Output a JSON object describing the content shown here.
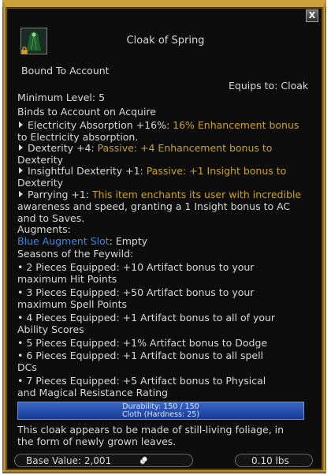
{
  "close_label": "X",
  "item": {
    "title": "Cloak of Spring",
    "bound": "Bound To Account",
    "equips_to": "Equips to: Cloak",
    "min_level": "Minimum Level: 5",
    "binds": "Binds to Account on Acquire",
    "effects": [
      {
        "name": "Electricity Absorption +16%:",
        "desc1": " 16% Enhancement bonus",
        "desc2": "to Electricity absorption."
      },
      {
        "name": "Dexterity +4:",
        "desc1": " Passive: +4 Enhancement bonus to",
        "desc2": "Dexterity"
      },
      {
        "name": "Insightful Dexterity +1:",
        "desc1": " Passive: +1 Insight bonus to",
        "desc2": "Dexterity"
      },
      {
        "name": "Parrying +1:",
        "desc1": " This item enchants its user with incredible",
        "desc2": "awareness and speed, granting a 1 Insight bonus to AC",
        "desc3": "and to Saves."
      }
    ],
    "augments_label": "Augments:",
    "augment_slot": "Blue Augment Slot",
    "augment_value": ": Empty",
    "set_name": "Seasons of the Feywild:",
    "set_bonuses": [
      "• 2 Pieces Equipped: +10 Artifact bonus to your",
      "maximum Hit Points",
      "• 3 Pieces Equipped: +50 Artifact bonus to your",
      "maximum Spell Points",
      "• 4 Pieces Equipped: +1 Artifact bonus to all of your",
      "Ability Scores",
      "• 5 Pieces Equipped: +1% Artifact bonus to Dodge",
      "• 6 Pieces Equipped: +1 Artifact bonus to all spell",
      "DCs",
      "• 7 Pieces Equipped: +5 Artifact bonus to Physical",
      "and Magical Resistance Rating"
    ],
    "durability": "Durability: 150 / 150",
    "material": "Cloth (Hardness: 25)",
    "durability_fraction": 1.0,
    "description": [
      "This cloak appears to be made of still-living foliage, in",
      "the form of newly grown leaves."
    ],
    "base_value": "Base Value: 2,001",
    "weight": "0.10 lbs"
  },
  "colors": {
    "gold": "#c6a230",
    "augment_blue": "#3a86e8",
    "set_teal": "#5fd4c2",
    "durability_bar": "#2a55b8"
  }
}
